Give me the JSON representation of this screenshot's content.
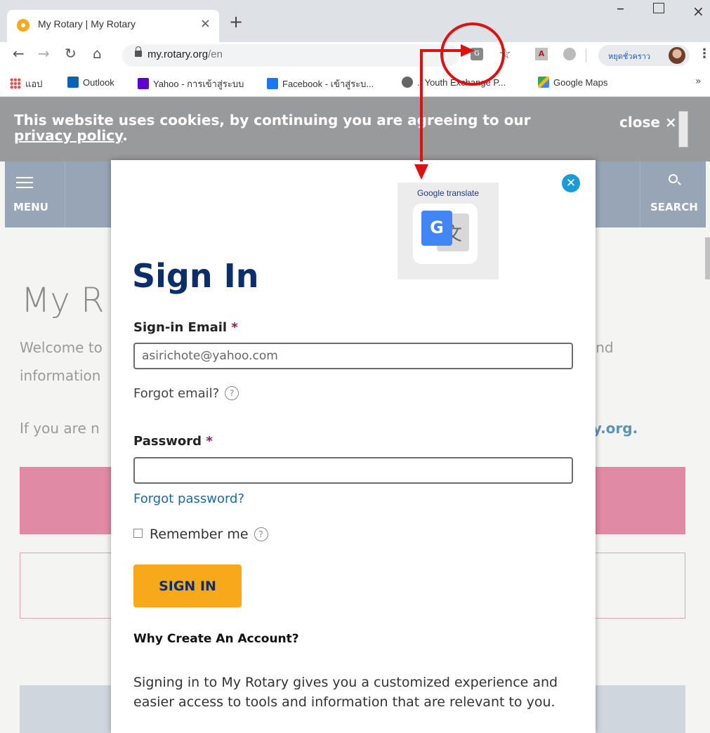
{
  "browser": {
    "tab_title": "My Rotary | My Rotary",
    "tab_close": "×",
    "new_tab": "+",
    "win_min": "–",
    "win_close": "×",
    "url_domain": "my.rotary.org",
    "url_path": "/en",
    "profile_name": "หยุดชั่วคราว",
    "bookmarks": [
      "แอป",
      "Outlook",
      "Yahoo - การเข้าสู่ระบบ",
      "Facebook - เข้าสู่ระบ...",
      ".: Youth Exchange P...",
      "Google Maps"
    ],
    "bookmarks_more": "»"
  },
  "site": {
    "cookie_text": "This website uses cookies, by continuing you are agreeing to our",
    "cookie_link": "privacy policy",
    "cookie_link_suffix": ".",
    "cookie_close": "close ×",
    "menu_label": "MENU",
    "search_label": "SEARCH",
    "bg_title": "My R",
    "bg_welcome": "Welcome to",
    "bg_info": "information",
    "bg_and": "and",
    "bg_ifyou": "If you are n",
    "bg_rylink": "ry.org."
  },
  "modal": {
    "close": "✕",
    "gt_label": "Google translate",
    "gt_front": "G",
    "gt_back": "文",
    "title": "Sign In",
    "email_label": "Sign-in Email",
    "required": "*",
    "email_value": "asirichote@yahoo.com",
    "forgot_email": "Forgot email?",
    "help": "?",
    "password_label": "Password",
    "forgot_password": "Forgot password?",
    "remember_me": "Remember me",
    "signin_button": "SIGN IN",
    "why_title": "Why Create An Account?",
    "why_desc": "Signing in to My Rotary gives you a customized experience and easier access to tools and information that are relevant to you."
  },
  "colors": {
    "annotation_red": "#e11010",
    "brand_navy": "#0c2f6b",
    "brand_gold": "#f7a81b"
  }
}
